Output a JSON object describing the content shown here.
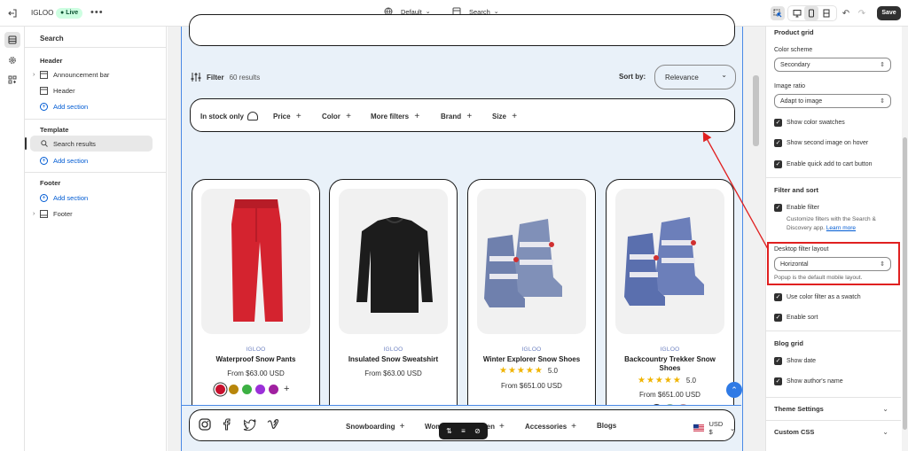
{
  "topbar": {
    "store_name": "IGLOO",
    "status": "Live",
    "theme_select": "Default",
    "template_select": "Search",
    "save_label": "Save"
  },
  "sidebar": {
    "title": "Search",
    "sections": {
      "header": "Header",
      "template": "Template",
      "footer": "Footer"
    },
    "header_items": [
      "Announcement bar",
      "Header"
    ],
    "template_items": [
      "Search results"
    ],
    "footer_items": [
      "Footer"
    ],
    "add_section": "Add section"
  },
  "preview": {
    "filter_label": "Filter",
    "results_count": "60 results",
    "sort_label": "Sort by:",
    "sort_value": "Relevance",
    "filters": [
      "In stock only",
      "Price",
      "Color",
      "More filters",
      "Brand",
      "Size"
    ],
    "products": [
      {
        "brand": "IGLOO",
        "title": "Waterproof Snow Pants",
        "price": "From $63.00 USD"
      },
      {
        "brand": "IGLOO",
        "title": "Insulated Snow Sweatshirt",
        "price": "From $63.00 USD"
      },
      {
        "brand": "IGLOO",
        "title": "Winter Explorer Snow Shoes",
        "rating": "5.0",
        "price": "From $651.00 USD"
      },
      {
        "brand": "IGLOO",
        "title": "Backcountry Trekker Snow Shoes",
        "rating": "5.0",
        "price": "From $651.00 USD"
      }
    ],
    "swatch_colors": [
      "#c8102e",
      "#b8860b",
      "#3cb043",
      "#9b30d9",
      "#a020a0"
    ],
    "nav": [
      "Snowboarding",
      "Women",
      "Men",
      "Accessories",
      "Blogs"
    ],
    "currency": "USD $"
  },
  "settings": {
    "product_grid_title": "Product grid",
    "color_scheme_label": "Color scheme",
    "color_scheme_value": "Secondary",
    "image_ratio_label": "Image ratio",
    "image_ratio_value": "Adapt to image",
    "show_color_swatches": "Show color swatches",
    "show_second_image": "Show second image on hover",
    "enable_quick_add": "Enable quick add to cart button",
    "filter_sort_title": "Filter and sort",
    "enable_filter": "Enable filter",
    "filter_help": "Customize filters with the Search & Discovery app.",
    "learn_more": "Learn more",
    "desktop_filter_label": "Desktop filter layout",
    "desktop_filter_value": "Horizontal",
    "popup_help": "Popup is the default mobile layout.",
    "use_color_swatch": "Use color filter as a swatch",
    "enable_sort": "Enable sort",
    "blog_grid_title": "Blog grid",
    "show_date": "Show date",
    "show_author": "Show author's name",
    "theme_settings": "Theme Settings",
    "custom_css": "Custom CSS"
  },
  "colors": {
    "accent_blue": "#005bd3",
    "annotation_red": "#e02020",
    "live_badge": "#cdfee1"
  }
}
